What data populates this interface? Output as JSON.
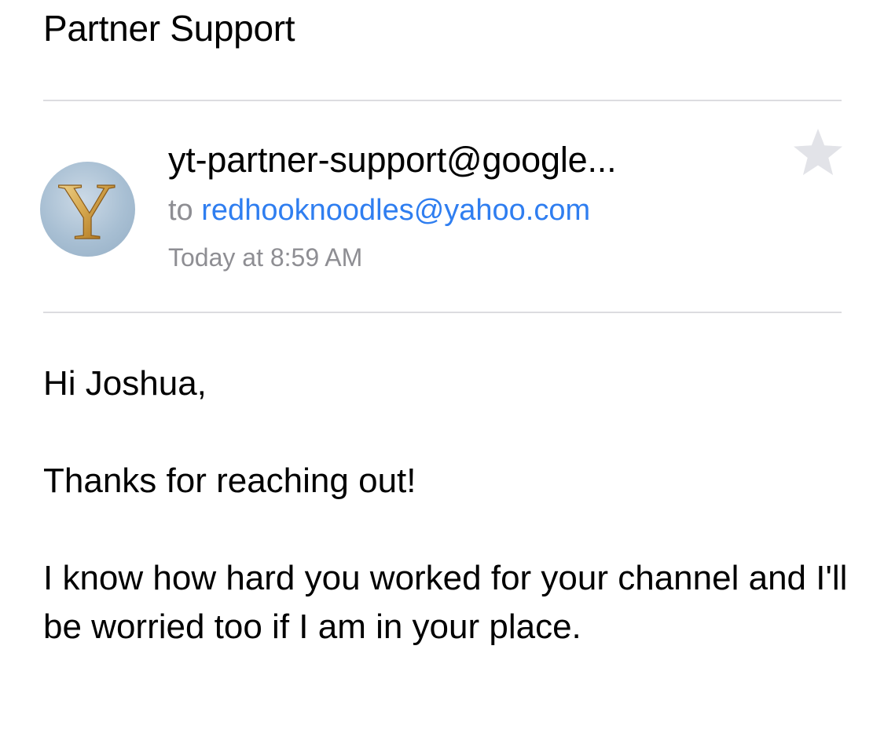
{
  "email": {
    "subject": "Partner Support",
    "sender": "yt-partner-support@google...",
    "to_label": "to",
    "recipient": "redhooknoodles@yahoo.com",
    "timestamp": "Today at 8:59 AM",
    "avatar_letter": "Y",
    "starred": false,
    "body": [
      "Hi Joshua,",
      "Thanks for reaching out!",
      "I know how hard you worked for your channel and I'll be worried too if I am in your place."
    ]
  },
  "colors": {
    "link": "#2f7ef0",
    "secondary_text": "#8e8e93",
    "divider": "#dcdce0",
    "star_inactive": "#e2e3e8"
  },
  "icons": {
    "star": "star-icon",
    "avatar": "sender-avatar"
  }
}
